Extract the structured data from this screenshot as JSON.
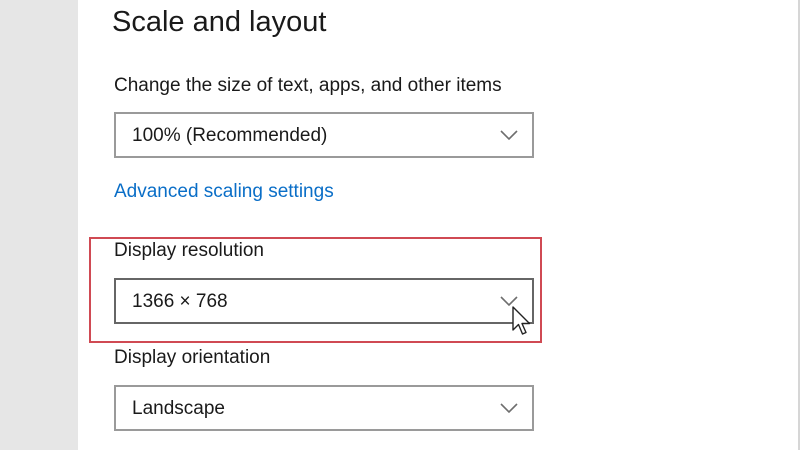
{
  "section": {
    "title": "Scale and layout"
  },
  "scale": {
    "label": "Change the size of text, apps, and other items",
    "selected": "100% (Recommended)"
  },
  "advanced_link": "Advanced scaling settings",
  "resolution": {
    "label": "Display resolution",
    "selected": "1366 × 768"
  },
  "orientation": {
    "label": "Display orientation",
    "selected": "Landscape"
  },
  "colors": {
    "link": "#0a6ec7",
    "highlight_border": "#d04a53",
    "dropdown_border": "#9a9a9a",
    "sidebar_bg": "#e6e6e6"
  },
  "icons": {
    "dropdown_arrow": "chevron-down-icon",
    "pointer": "mouse-cursor-icon"
  }
}
